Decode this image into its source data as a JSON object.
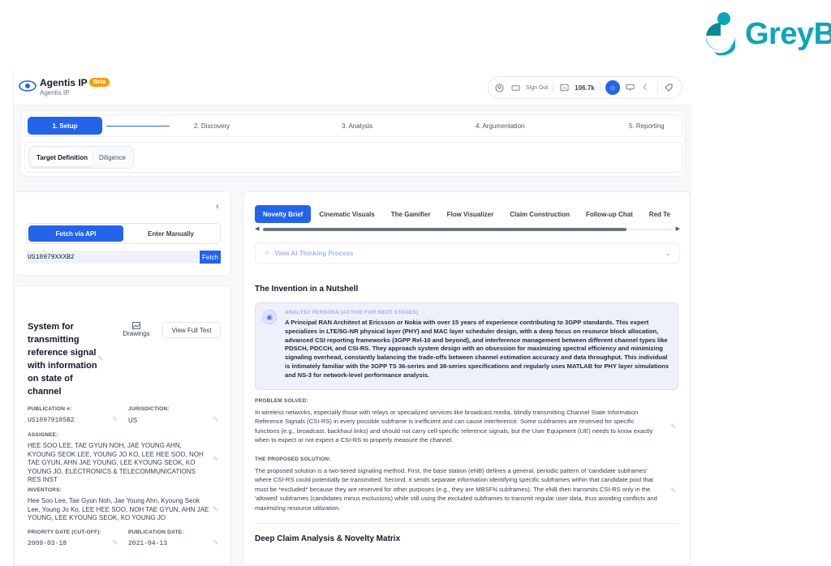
{
  "brand": {
    "name": "GreyB",
    "color": "#0ea5b7"
  },
  "header": {
    "app_title": "Agentis IP",
    "beta": "Beta",
    "subtitle": "Agentis IP",
    "sign_out": "Sign Out",
    "credits": "106.7k",
    "icons": [
      "user-circle-icon",
      "card-icon",
      "credits-icon",
      "sun-icon",
      "monitor-icon",
      "moon-icon",
      "tag-icon"
    ]
  },
  "stepper": {
    "steps": [
      "1. Setup",
      "2. Discovery",
      "3. Analysis",
      "4. Argumentation",
      "5. Reporting"
    ],
    "active_index": 0
  },
  "subtabs": {
    "items": [
      "Target Definition",
      "Diligence"
    ],
    "active_index": 0
  },
  "fetch": {
    "modes": [
      "Fetch via API",
      "Enter Manually"
    ],
    "active_index": 0,
    "patent_input": "US10979XXXB2",
    "fetch_label": "Fetch"
  },
  "patent": {
    "title_lines": [
      "System for",
      "transmitting",
      "reference signal",
      "with information",
      "on state of",
      "channel"
    ],
    "drawings_label": "Drawings",
    "full_text_label": "View Full Text",
    "publication_label": "PUBLICATION #:",
    "publication": "US10979185B2",
    "jurisdiction_label": "JURISDICTION:",
    "jurisdiction": "US",
    "assignee_label": "ASSIGNEE:",
    "assignee": "HEE SOO LEE, TAE GYUN NOH, JAE YOUNG AHN, KYOUNG SEOK LEE, YOUNG JO KO, LEE HEE SOO, NOH TAE GYUN, AHN JAE YOUNG, LEE KYOUNG SEOK, KO YOUNG JO, ELECTRONICS & TELECOMMUNICATIONS RES INST",
    "inventors_label": "INVENTORS:",
    "inventors": "Hee Soo Lee, Tae Gyun Noh, Jae Young Ahn, Kyoung Seok Lee, Young Jo Ko, LEE HEE SOO, NOH TAE GYUN, AHN JAE YOUNG, LEE KYOUNG SEOK, KO YOUNG JO",
    "priority_label": "PRIORITY DATE (CUT-OFF):",
    "priority": "2009-03-18",
    "pubdate_label": "PUBLICATION DATE:",
    "pubdate": "2021-04-13"
  },
  "main": {
    "tabs": [
      "Novelty Brief",
      "Cinematic Visuals",
      "The Gamifier",
      "Flow Visualizer",
      "Claim Construction",
      "Follow-up Chat",
      "Red Te"
    ],
    "active_tab": 0,
    "thinking_label": "View AI Thinking Process",
    "nutshell_heading": "The Invention in a Nutshell",
    "persona_label": "ANALYST PERSONA (ACTIVE FOR NEXT STAGES)",
    "persona_text": "A Principal RAN Architect at Ericsson or Nokia with over 15 years of experience contributing to 3GPP standards. This expert specializes in LTE/5G-NR physical layer (PHY) and MAC layer scheduler design, with a deep focus on resource block allocation, advanced CSI reporting frameworks (3GPP Rel-10 and beyond), and interference management between different channel types like PDSCH, PDCCH, and CSI-RS. They approach system design with an obsession for maximizing spectral efficiency and minimizing signaling overhead, constantly balancing the trade-offs between channel estimation accuracy and data throughput. This individual is intimately familiar with the 3GPP TS 36-series and 38-series specifications and regularly uses MATLAB for PHY layer simulations and NS-3 for network-level performance analysis.",
    "problem_label": "PROBLEM SOLVED:",
    "problem_text": "In wireless networks, especially those with relays or specialized services like broadcast media, blindly transmitting Channel State Information Reference Signals (CSI-RS) in every possible subframe is inefficient and can cause interference. Some subframes are reserved for specific functions (e.g., broadcast, backhaul links) and should not carry cell-specific reference signals, but the User Equipment (UE) needs to know exactly when to expect or not expect a CSI-RS to properly measure the channel.",
    "solution_label": "THE PROPOSED SOLUTION:",
    "solution_text": "The proposed solution is a two-tiered signaling method. First, the base station (eNB) defines a general, periodic pattern of 'candidate subframes' where CSI-RS could potentially be transmitted. Second, it sends separate information identifying specific subframes within that candidate pool that must be *excluded* because they are reserved for other purposes (e.g., they are MBSFN subframes). The eNB then transmits CSI-RS only in the 'allowed' subframes (candidates minus exclusions) while still using the excluded subframes to transmit regular user data, thus avoiding conflicts and maximizing resource utilization.",
    "claim_heading": "Deep Claim Analysis & Novelty Matrix"
  },
  "colors": {
    "accent": "#2563eb",
    "persona_bg": "#eef0fc",
    "beta": "#f59e0b"
  }
}
